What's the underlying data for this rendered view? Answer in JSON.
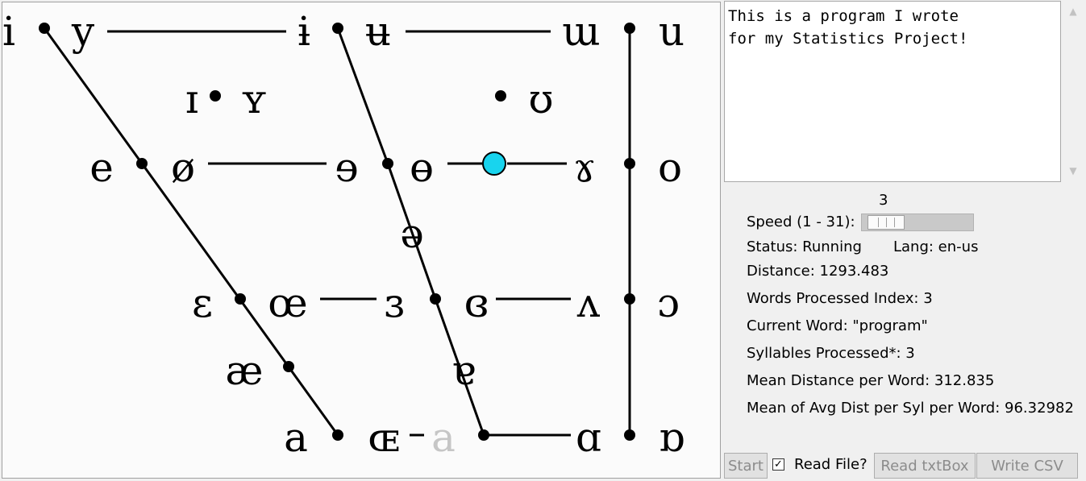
{
  "vowel_chart": {
    "symbols": [
      {
        "char": "i"
      },
      {
        "char": "y"
      },
      {
        "char": "ɨ"
      },
      {
        "char": "ʉ"
      },
      {
        "char": "ɯ"
      },
      {
        "char": "u"
      },
      {
        "char": "ɪ"
      },
      {
        "char": "ʏ"
      },
      {
        "char": "ʊ"
      },
      {
        "char": "e"
      },
      {
        "char": "ø"
      },
      {
        "char": "ɘ"
      },
      {
        "char": "ɵ"
      },
      {
        "char": "ɤ"
      },
      {
        "char": "o"
      },
      {
        "char": "ə"
      },
      {
        "char": "ɛ"
      },
      {
        "char": "œ"
      },
      {
        "char": "ɜ"
      },
      {
        "char": "ɞ"
      },
      {
        "char": "ʌ"
      },
      {
        "char": "ɔ"
      },
      {
        "char": "æ"
      },
      {
        "char": "ɐ"
      },
      {
        "char": "a"
      },
      {
        "char": "ɶ"
      },
      {
        "char": "a",
        "faded": true
      },
      {
        "char": "ɑ"
      },
      {
        "char": "ɒ"
      }
    ],
    "marker_color": "#18d4ee"
  },
  "textbox": {
    "text": "This is a program I wrote\nfor my Statistics Project!"
  },
  "speed": {
    "value": "3",
    "label": "Speed (1 - 31):",
    "fraction": 0.067
  },
  "status": {
    "status_text": "Status: Running",
    "lang_text": "Lang: en-us",
    "distance_text": "Distance: 1293.483",
    "words_processed_text": "Words Processed Index: 3",
    "current_word_text": "Current Word: \"program\"",
    "syllables_text": "Syllables Processed*: 3",
    "mean_distance_text": "Mean Distance per Word: 312.835",
    "mean_avg_text": "Mean of Avg Dist per Syl per Word: 96.32982"
  },
  "buttons": {
    "start": "Start",
    "read_file": "Read File?",
    "read_file_checked": "✓",
    "read_txtbox": "Read txtBox",
    "write_csv": "Write CSV"
  }
}
